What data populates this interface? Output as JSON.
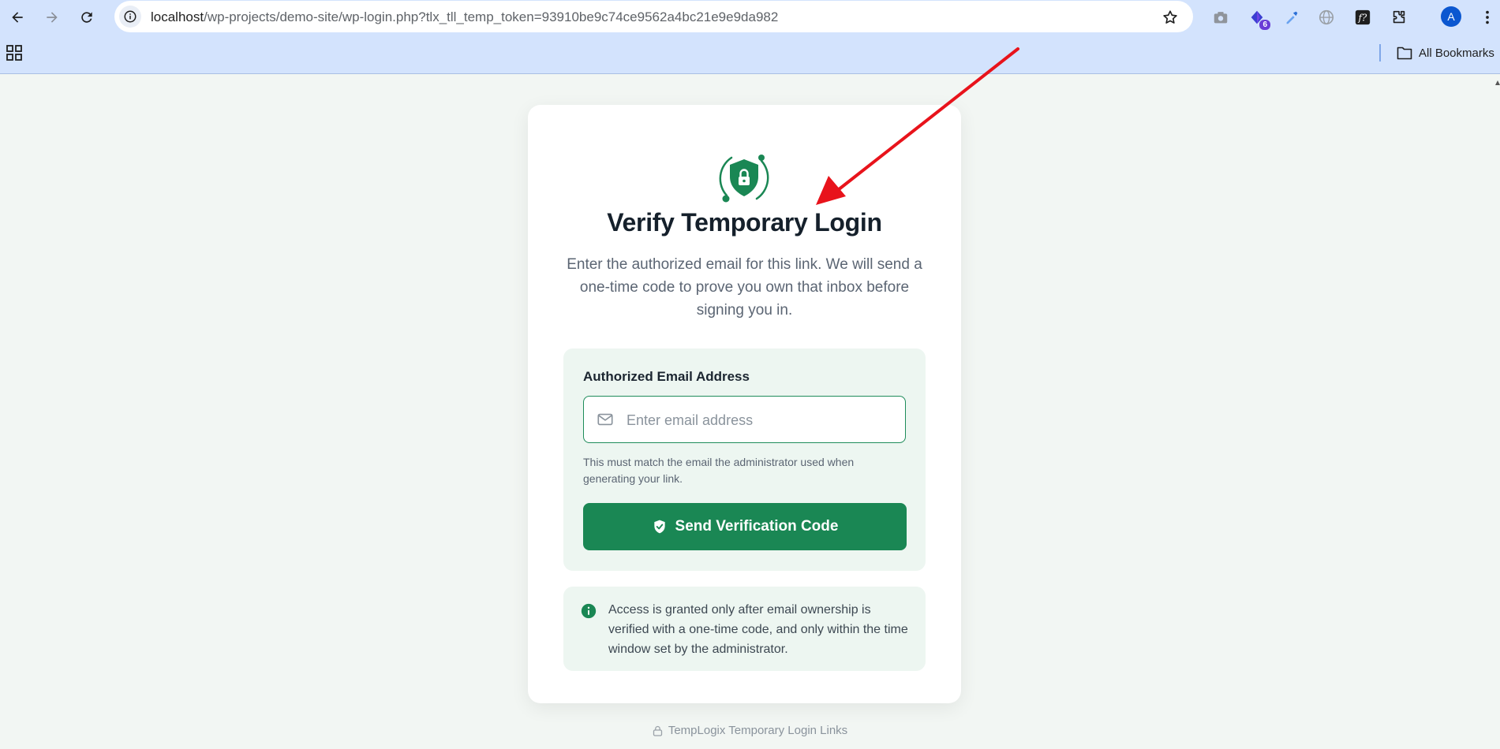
{
  "browser": {
    "url_host": "localhost",
    "url_path": "/wp-projects/demo-site/wp-login.php?tlx_tll_temp_token=93910be9c74ce9562a4bc21e9e9da982",
    "extension_badge": "6",
    "profile_initial": "A",
    "all_bookmarks_label": "All Bookmarks"
  },
  "page": {
    "title": "Verify Temporary Login",
    "subtitle": "Enter the authorized email for this link. We will send a one-time code to prove you own that inbox before signing you in.",
    "email_label": "Authorized Email Address",
    "email_placeholder": "Enter email address",
    "email_value": "",
    "hint": "This must match the email the administrator used when generating your link.",
    "send_button": "Send Verification Code",
    "info": "Access is granted only after email ownership is verified with a one-time code, and only within the time window set by the administrator.",
    "footer": "TempLogix Temporary Login Links"
  },
  "colors": {
    "brand_green": "#1a8754",
    "panel_tint": "#edf6f1",
    "chrome_blue": "#d3e3fd",
    "annotation_red": "#e8131b"
  }
}
